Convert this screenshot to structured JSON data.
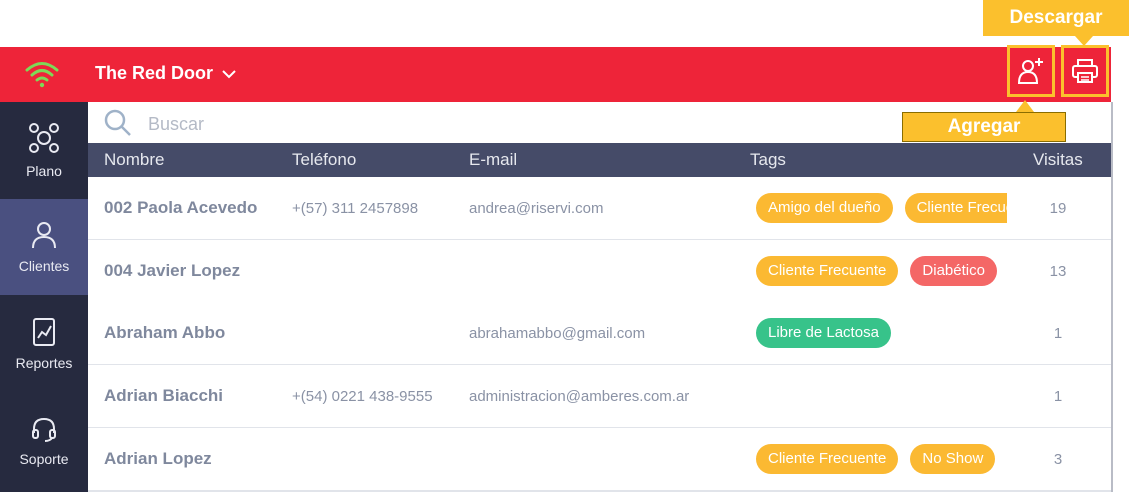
{
  "callouts": {
    "download": "Descargar",
    "add": "Agregar"
  },
  "header": {
    "restaurant": "The Red Door"
  },
  "sidebar": {
    "items": [
      {
        "label": "Plano",
        "icon": "floor-plan-icon",
        "active": false
      },
      {
        "label": "Clientes",
        "icon": "user-icon",
        "active": true
      },
      {
        "label": "Reportes",
        "icon": "report-icon",
        "active": false
      },
      {
        "label": "Soporte",
        "icon": "headset-icon",
        "active": false
      }
    ]
  },
  "search": {
    "placeholder": "Buscar"
  },
  "table": {
    "columns": [
      "Nombre",
      "Teléfono",
      "E-mail",
      "Tags",
      "Visitas"
    ],
    "rows": [
      {
        "name": "002 Paola Acevedo",
        "phone": "+(57) 311 2457898",
        "email": "andrea@riservi.com",
        "tags": [
          {
            "label": "Amigo del dueño",
            "color": "#fbb932"
          },
          {
            "label": "Cliente Frecuente",
            "color": "#fbb932"
          }
        ],
        "visits": "19"
      },
      {
        "name": "004 Javier Lopez",
        "phone": "",
        "email": "",
        "tags": [
          {
            "label": "Cliente Frecuente",
            "color": "#fbb932"
          },
          {
            "label": "Diabético",
            "color": "#f46766"
          }
        ],
        "visits": "13"
      },
      {
        "name": "Abraham Abbo",
        "phone": "",
        "email": "abrahamabbo@gmail.com",
        "tags": [
          {
            "label": "Libre de Lactosa",
            "color": "#37c38a"
          }
        ],
        "visits": "1"
      },
      {
        "name": "Adrian Biacchi",
        "phone": "+(54) 0221 438-9555",
        "email": "administracion@amberes.com.ar",
        "tags": [],
        "visits": "1"
      },
      {
        "name": "Adrian Lopez",
        "phone": "",
        "email": "",
        "tags": [
          {
            "label": "Cliente Frecuente",
            "color": "#fbb932"
          },
          {
            "label": "No Show",
            "color": "#fbb932"
          }
        ],
        "visits": "3"
      }
    ]
  },
  "colors": {
    "header": "#ee2439",
    "sidebar": "#262a3f",
    "sidebar_active": "#4a5080",
    "table_header": "#454b68",
    "callout": "#fbc02d"
  }
}
